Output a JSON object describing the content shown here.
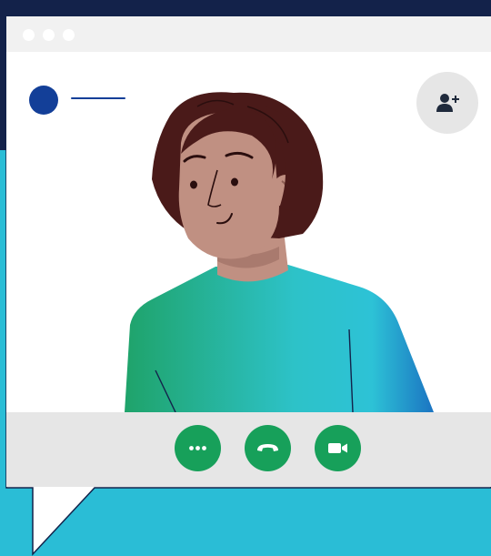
{
  "window": {
    "titlebar_dots": [
      "dot",
      "dot",
      "dot"
    ]
  },
  "caller": {
    "avatar_color": "#133F98",
    "name_placeholder_color": "#133F98"
  },
  "controls": {
    "add_user_icon": "add-user-icon",
    "more_icon": "more-options-icon",
    "hangup_icon": "phone-hangup-icon",
    "video_icon": "video-camera-icon"
  },
  "colors": {
    "background": "#2ABDD6",
    "header_band": "#13224A",
    "window": "#FFFFFF",
    "titlebar": "#F1F1F1",
    "control_bar": "#E6E6E6",
    "control_button": "#17A05A",
    "add_user_button": "#E6E6E6"
  }
}
